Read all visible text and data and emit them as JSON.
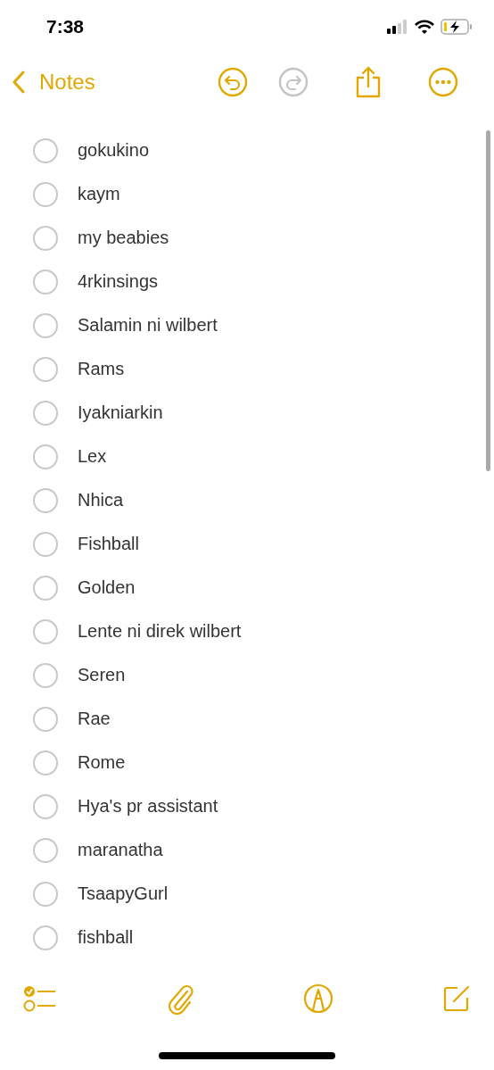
{
  "status_bar": {
    "time": "7:38"
  },
  "nav": {
    "back_label": "Notes",
    "actions": [
      {
        "kind": "undo",
        "disabled": false
      },
      {
        "kind": "redo",
        "disabled": true
      },
      {
        "kind": "share",
        "disabled": false
      },
      {
        "kind": "more",
        "disabled": false
      }
    ]
  },
  "checklist": [
    {
      "text": "gokukino",
      "checked": false
    },
    {
      "text": "kaym",
      "checked": false
    },
    {
      "text": "my beabies",
      "checked": false
    },
    {
      "text": "4rkinsings",
      "checked": false
    },
    {
      "text": "Salamin ni wilbert",
      "checked": false
    },
    {
      "text": "Rams",
      "checked": false
    },
    {
      "text": "Iyakniarkin",
      "checked": false
    },
    {
      "text": "Lex",
      "checked": false
    },
    {
      "text": "Nhica",
      "checked": false
    },
    {
      "text": "Fishball",
      "checked": false
    },
    {
      "text": "Golden",
      "checked": false
    },
    {
      "text": "Lente ni direk wilbert",
      "checked": false
    },
    {
      "text": "Seren",
      "checked": false
    },
    {
      "text": "Rae",
      "checked": false
    },
    {
      "text": "Rome",
      "checked": false
    },
    {
      "text": "Hya's pr assistant",
      "checked": false
    },
    {
      "text": "maranatha",
      "checked": false
    },
    {
      "text": "TsaapyGurl",
      "checked": false
    },
    {
      "text": "fishball",
      "checked": false
    }
  ],
  "toolbar": [
    {
      "kind": "checklist"
    },
    {
      "kind": "attach"
    },
    {
      "kind": "markup"
    },
    {
      "kind": "compose"
    }
  ]
}
